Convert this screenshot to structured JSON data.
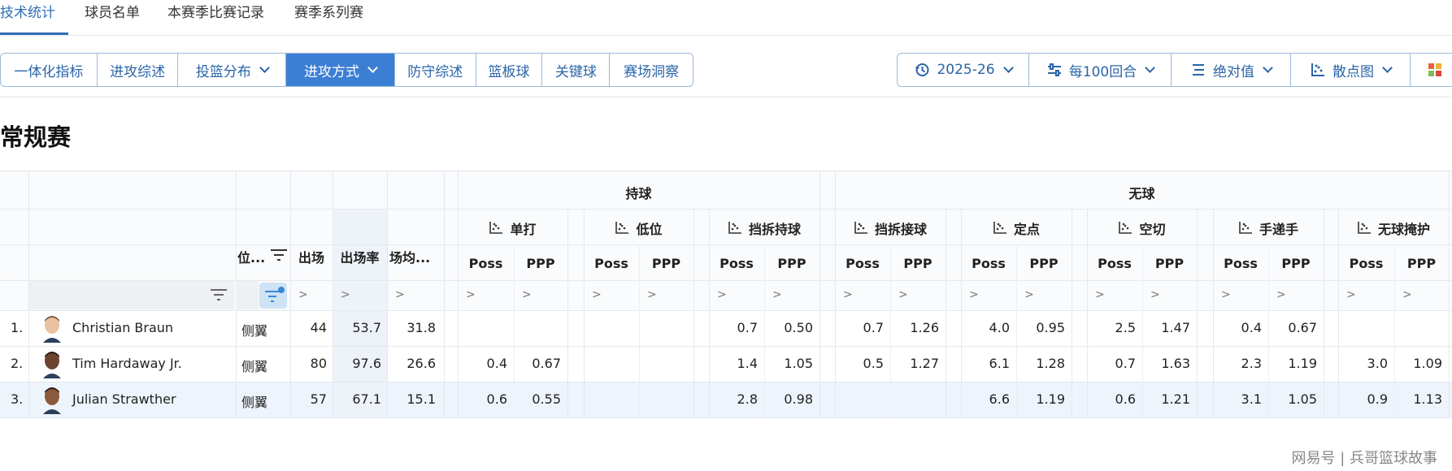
{
  "top_tabs": [
    {
      "label": "技术统计",
      "active": true
    },
    {
      "label": "球员名单",
      "active": false
    },
    {
      "label": "本赛季比赛记录",
      "active": false
    },
    {
      "label": "赛季系列赛",
      "active": false
    }
  ],
  "category_tabs": [
    {
      "label": "一体化指标",
      "active": false,
      "dropdown": false
    },
    {
      "label": "进攻综述",
      "active": false,
      "dropdown": false
    },
    {
      "label": "投篮分布",
      "active": false,
      "dropdown": true
    },
    {
      "label": "进攻方式",
      "active": true,
      "dropdown": true
    },
    {
      "label": "防守综述",
      "active": false,
      "dropdown": false
    },
    {
      "label": "篮板球",
      "active": false,
      "dropdown": false
    },
    {
      "label": "关键球",
      "active": false,
      "dropdown": false
    },
    {
      "label": "赛场洞察",
      "active": false,
      "dropdown": false
    }
  ],
  "options": {
    "season": {
      "label": "2025-26",
      "icon": "history-icon"
    },
    "per": {
      "label": "每100回合",
      "icon": "sliders-icon"
    },
    "mode": {
      "label": "绝对值",
      "icon": "list-icon"
    },
    "view": {
      "label": "散点图",
      "icon": "scatter-icon"
    }
  },
  "section_title": "常规赛",
  "table": {
    "group_headers": {
      "with_ball": "持球",
      "without_ball": "无球"
    },
    "play_types": [
      "单打",
      "低位",
      "挡拆持球",
      "挡拆接球",
      "定点",
      "空切",
      "手递手",
      "无球掩护"
    ],
    "metric_headers": {
      "poss": "Poss",
      "ppp": "PPP"
    },
    "info_headers": {
      "position": "位...",
      "games": "出场",
      "game_rate": "出场率",
      "minutes": "场均..."
    },
    "filter_symbol": ">",
    "rows": [
      {
        "rank": "1.",
        "name": "Christian Braun",
        "position": "侧翼",
        "games": "44",
        "game_rate": "53.7",
        "minutes": "31.8",
        "stats": [
          [
            "",
            ""
          ],
          [
            "",
            ""
          ],
          [
            "0.7",
            "0.50"
          ],
          [
            "0.7",
            "1.26"
          ],
          [
            "4.0",
            "0.95"
          ],
          [
            "2.5",
            "1.47"
          ],
          [
            "0.4",
            "0.67"
          ],
          [
            "",
            ""
          ]
        ]
      },
      {
        "rank": "2.",
        "name": "Tim Hardaway Jr.",
        "position": "侧翼",
        "games": "80",
        "game_rate": "97.6",
        "minutes": "26.6",
        "stats": [
          [
            "0.4",
            "0.67"
          ],
          [
            "",
            ""
          ],
          [
            "1.4",
            "1.05"
          ],
          [
            "0.5",
            "1.27"
          ],
          [
            "6.1",
            "1.28"
          ],
          [
            "0.7",
            "1.63"
          ],
          [
            "2.3",
            "1.19"
          ],
          [
            "3.0",
            "1.09"
          ]
        ]
      },
      {
        "rank": "3.",
        "name": "Julian Strawther",
        "position": "侧翼",
        "games": "57",
        "game_rate": "67.1",
        "minutes": "15.1",
        "stats": [
          [
            "0.6",
            "0.55"
          ],
          [
            "",
            ""
          ],
          [
            "2.8",
            "0.98"
          ],
          [
            "",
            ""
          ],
          [
            "6.6",
            "1.19"
          ],
          [
            "0.6",
            "1.21"
          ],
          [
            "3.1",
            "1.05"
          ],
          [
            "0.9",
            "1.13"
          ]
        ]
      }
    ]
  },
  "watermark": "网易号 | 兵哥篮球故事",
  "colors": {
    "accent": "#2f6fb6",
    "active_tab_bg": "#3b7fd4"
  }
}
